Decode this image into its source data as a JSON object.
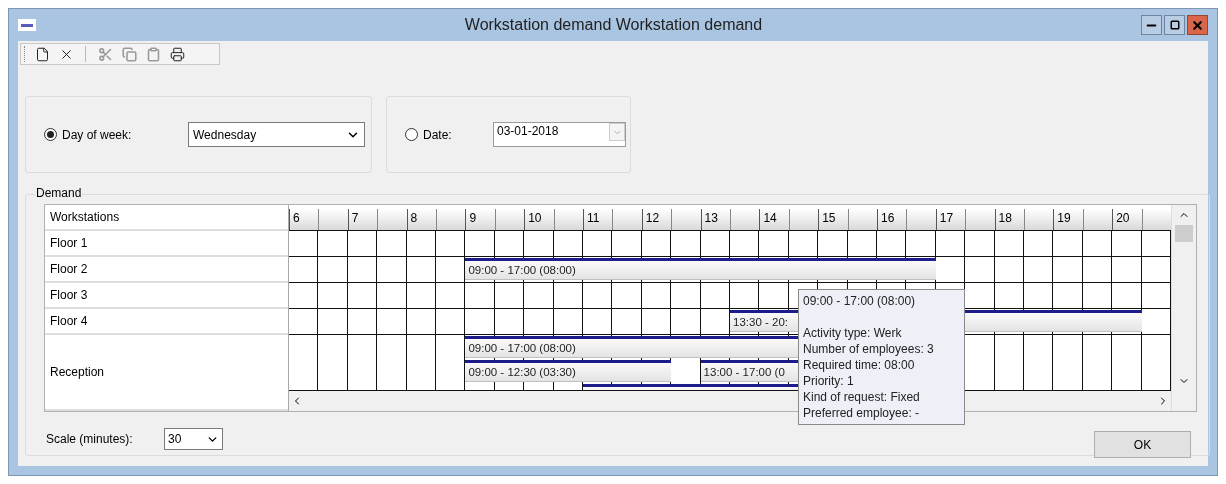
{
  "window": {
    "title": "Workstation demand Workstation demand"
  },
  "toolbar": [
    {
      "kind": "new",
      "disabled": false
    },
    {
      "kind": "delete",
      "disabled": false
    },
    {
      "kind": "separator"
    },
    {
      "kind": "cut",
      "disabled": true
    },
    {
      "kind": "copy",
      "disabled": true
    },
    {
      "kind": "paste",
      "disabled": true
    },
    {
      "kind": "print",
      "disabled": false
    }
  ],
  "filter": {
    "day_of_week": {
      "label": "Day of week:",
      "selected": true,
      "value": "Wednesday"
    },
    "date": {
      "label": "Date:",
      "selected": false,
      "value": "03-01-2018"
    }
  },
  "demand": {
    "title": "Demand",
    "column_header": "Workstations",
    "hours": [
      "6",
      "7",
      "8",
      "9",
      "10",
      "11",
      "12",
      "13",
      "14",
      "15",
      "16",
      "17",
      "18",
      "19",
      "20"
    ],
    "rows": [
      {
        "name": "Floor 1"
      },
      {
        "name": "Floor 2",
        "lanes": [
          [
            {
              "kind": "bar",
              "label": "09:00 - 17:00 (08:00)"
            }
          ]
        ]
      },
      {
        "name": "Floor 3"
      },
      {
        "name": "Floor 4",
        "lanes": [
          [
            {
              "kind": "bar",
              "label": "13:30 - 20:"
            }
          ]
        ]
      },
      {
        "name": "Reception",
        "lanes": [
          [
            {
              "kind": "bar",
              "label": "09:00 - 17:00 (08:00)"
            }
          ],
          [
            {
              "kind": "bar",
              "label": "09:00 - 12:30 (03:30)"
            },
            {
              "kind": "bar",
              "label": "13:00 - 17:00 (0"
            }
          ],
          [
            {
              "kind": "bar"
            }
          ]
        ]
      }
    ],
    "tooltip": {
      "title": "09:00 - 17:00 (08:00)",
      "lines": [
        "Activity type: Werk",
        "Number of employees: 3",
        "Required time: 08:00",
        "Priority: 1",
        "Kind of request: Fixed",
        "Preferred employee: -"
      ]
    }
  },
  "scale": {
    "label": "Scale (minutes):",
    "value": "30"
  },
  "ok_button": "OK"
}
